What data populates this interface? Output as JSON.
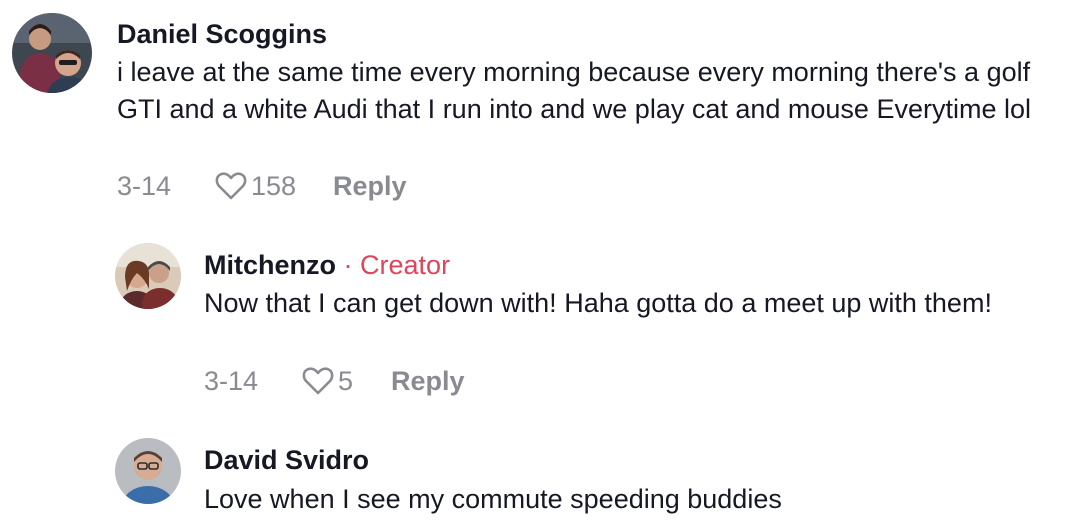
{
  "comments": [
    {
      "author": "Daniel Scoggins",
      "text": "i leave at the same time every morning because every morning there's a golf GTI and a white Audi that I run into and we play cat and mouse Everytime lol",
      "date": "3-14",
      "likes": "158",
      "reply_label": "Reply",
      "avatar_icon": "profile-photo-couple"
    },
    {
      "author": "Mitchenzo",
      "separator": "·",
      "badge": "Creator",
      "text": "Now that I can get down with! Haha gotta do a meet up with them!",
      "date": "3-14",
      "likes": "5",
      "reply_label": "Reply",
      "avatar_icon": "profile-photo-couple"
    },
    {
      "author": "David Svidro",
      "text": "Love when I see my commute speeding buddies",
      "avatar_icon": "profile-photo-man"
    }
  ],
  "colors": {
    "creator_badge": "#e0445a",
    "meta_text": "#8a8b91",
    "primary_text": "#161823"
  }
}
